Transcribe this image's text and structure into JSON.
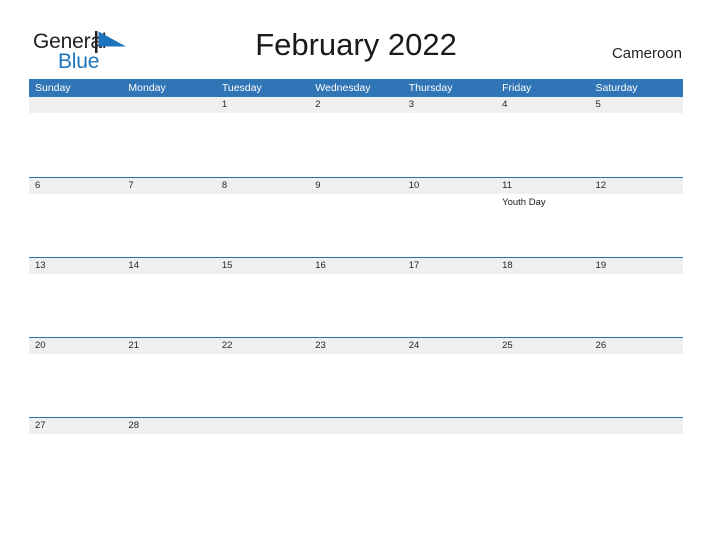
{
  "brand": {
    "name_part1": "General",
    "name_part2": "Blue",
    "flag_icon": "blue-flag-triangle-icon",
    "color_dark": "#231F20",
    "color_blue": "#1C75BC"
  },
  "header": {
    "title": "February 2022",
    "locale": "Cameroon"
  },
  "theme": {
    "header_blue": "#3075B5",
    "row_divider_blue": "#2C6FAF",
    "number_band_gray": "#EFEFEF",
    "text_dark": "#262626"
  },
  "calendar": {
    "weekdays": [
      "Sunday",
      "Monday",
      "Tuesday",
      "Wednesday",
      "Thursday",
      "Friday",
      "Saturday"
    ],
    "weeks": [
      {
        "days": [
          {
            "number": "",
            "events": []
          },
          {
            "number": "",
            "events": []
          },
          {
            "number": "1",
            "events": []
          },
          {
            "number": "2",
            "events": []
          },
          {
            "number": "3",
            "events": []
          },
          {
            "number": "4",
            "events": []
          },
          {
            "number": "5",
            "events": []
          }
        ]
      },
      {
        "days": [
          {
            "number": "6",
            "events": []
          },
          {
            "number": "7",
            "events": []
          },
          {
            "number": "8",
            "events": []
          },
          {
            "number": "9",
            "events": []
          },
          {
            "number": "10",
            "events": []
          },
          {
            "number": "11",
            "events": [
              "Youth Day"
            ]
          },
          {
            "number": "12",
            "events": []
          }
        ]
      },
      {
        "days": [
          {
            "number": "13",
            "events": []
          },
          {
            "number": "14",
            "events": []
          },
          {
            "number": "15",
            "events": []
          },
          {
            "number": "16",
            "events": []
          },
          {
            "number": "17",
            "events": []
          },
          {
            "number": "18",
            "events": []
          },
          {
            "number": "19",
            "events": []
          }
        ]
      },
      {
        "days": [
          {
            "number": "20",
            "events": []
          },
          {
            "number": "21",
            "events": []
          },
          {
            "number": "22",
            "events": []
          },
          {
            "number": "23",
            "events": []
          },
          {
            "number": "24",
            "events": []
          },
          {
            "number": "25",
            "events": []
          },
          {
            "number": "26",
            "events": []
          }
        ]
      },
      {
        "days": [
          {
            "number": "27",
            "events": []
          },
          {
            "number": "28",
            "events": []
          },
          {
            "number": "",
            "events": []
          },
          {
            "number": "",
            "events": []
          },
          {
            "number": "",
            "events": []
          },
          {
            "number": "",
            "events": []
          },
          {
            "number": "",
            "events": []
          }
        ]
      }
    ]
  }
}
